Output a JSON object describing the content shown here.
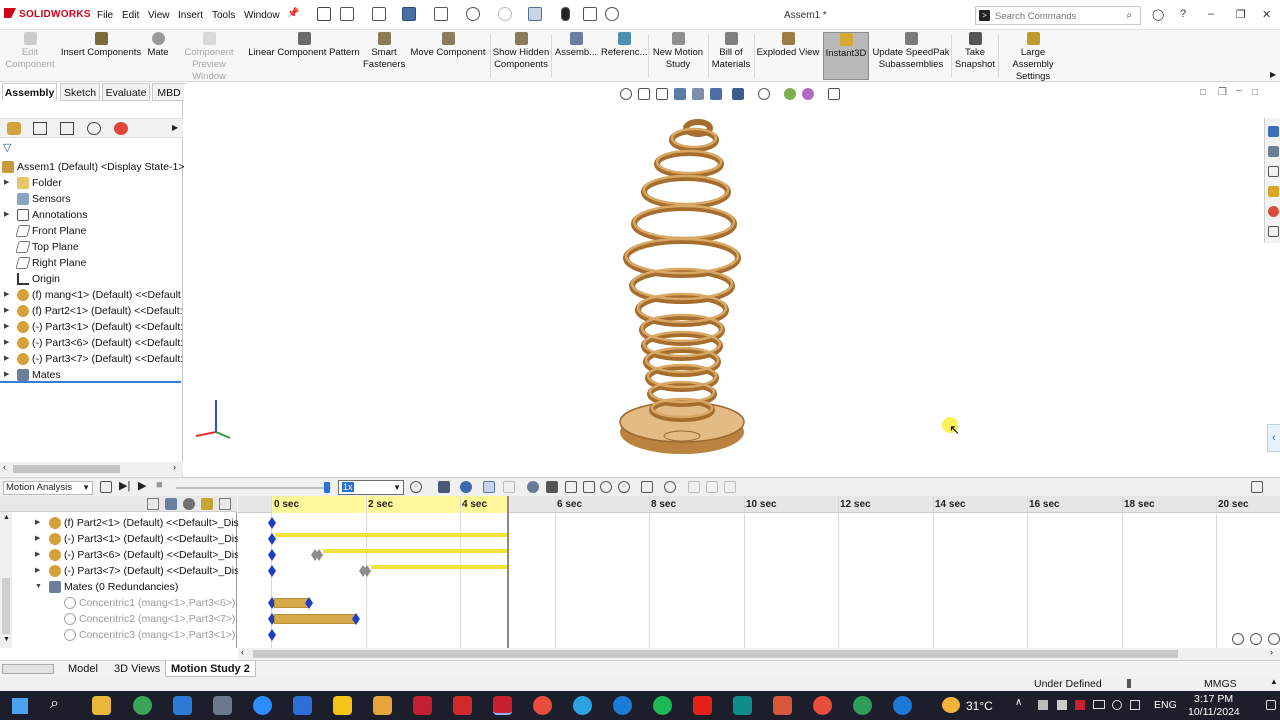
{
  "app": {
    "brand": "SOLIDWORKS",
    "document_title": "Assem1 *"
  },
  "menu": [
    "File",
    "Edit",
    "View",
    "Insert",
    "Tools",
    "Window"
  ],
  "search": {
    "placeholder": "Search Commands"
  },
  "commands": [
    {
      "label": "Edit\nComponent",
      "disabled": true,
      "icon": "edit-component-icon"
    },
    {
      "label": "Insert Components",
      "disabled": false,
      "icon": "insert-components-icon"
    },
    {
      "label": "Mate",
      "disabled": false,
      "icon": "mate-icon"
    },
    {
      "label": "Component\nPreview Window",
      "disabled": true,
      "icon": "preview-window-icon"
    },
    {
      "label": "Linear Component Pattern",
      "disabled": false,
      "icon": "linear-pattern-icon"
    },
    {
      "label": "Smart\nFasteners",
      "disabled": false,
      "icon": "smart-fasteners-icon"
    },
    {
      "label": "Move Component",
      "disabled": false,
      "icon": "move-component-icon"
    },
    {
      "label": "Show Hidden\nComponents",
      "disabled": false,
      "icon": "show-hidden-icon"
    },
    {
      "label": "Assemb...",
      "disabled": false,
      "icon": "assembly-features-icon"
    },
    {
      "label": "Referenc...",
      "disabled": false,
      "icon": "reference-geometry-icon"
    },
    {
      "label": "New Motion\nStudy",
      "disabled": false,
      "icon": "motion-study-icon"
    },
    {
      "label": "Bill of\nMaterials",
      "disabled": false,
      "icon": "bom-icon"
    },
    {
      "label": "Exploded View",
      "disabled": false,
      "icon": "exploded-view-icon"
    },
    {
      "label": "Instant3D",
      "disabled": false,
      "active": true,
      "icon": "instant3d-icon"
    },
    {
      "label": "Update SpeedPak\nSubassemblies",
      "disabled": false,
      "icon": "speedpak-icon"
    },
    {
      "label": "Take\nSnapshot",
      "disabled": false,
      "icon": "snapshot-icon"
    },
    {
      "label": "Large Assembly\nSettings",
      "disabled": false,
      "icon": "large-assembly-icon"
    }
  ],
  "cm_tabs": [
    "Assembly",
    "Sketch",
    "Evaluate",
    "MBD"
  ],
  "feature_tree": {
    "root": "Assem1 (Default) <Display State-1>",
    "items": [
      {
        "label": "Folder",
        "icon": "folder-icon"
      },
      {
        "label": "Sensors",
        "icon": "sensor-icon"
      },
      {
        "label": "Annotations",
        "icon": "annotations-icon"
      },
      {
        "label": "Front Plane",
        "icon": "plane-icon"
      },
      {
        "label": "Top Plane",
        "icon": "plane-icon"
      },
      {
        "label": "Right Plane",
        "icon": "plane-icon"
      },
      {
        "label": "Origin",
        "icon": "origin-icon"
      },
      {
        "label": "(f) mang<1> (Default) <<Default",
        "icon": "part-icon"
      },
      {
        "label": "(f) Part2<1> (Default) <<Default:",
        "icon": "part-icon"
      },
      {
        "label": "(-) Part3<1> (Default) <<Default:",
        "icon": "part-icon"
      },
      {
        "label": "(-) Part3<6> (Default) <<Default:",
        "icon": "part-icon"
      },
      {
        "label": "(-) Part3<7> (Default) <<Default:",
        "icon": "part-icon"
      },
      {
        "label": "Mates",
        "icon": "mates-icon"
      }
    ]
  },
  "motion": {
    "study_type": "Motion Analysis",
    "speed_value": "1x",
    "ticks": [
      "0 sec",
      "2 sec",
      "4 sec",
      "6 sec",
      "8 sec",
      "10 sec",
      "12 sec",
      "14 sec",
      "16 sec",
      "18 sec",
      "20 sec"
    ],
    "tree": [
      {
        "label": "(f) Part2<1> (Default) <<Default>_Dis",
        "dim": false
      },
      {
        "label": "(-) Part3<1> (Default) <<Default>_Dis",
        "dim": false
      },
      {
        "label": "(-) Part3<6> (Default) <<Default>_Dis",
        "dim": false
      },
      {
        "label": "(-) Part3<7> (Default) <<Default>_Dis",
        "dim": false
      },
      {
        "label": "Mates (0 Redundancies)",
        "dim": false
      },
      {
        "label": "Concentric1 (mang<1>,Part3<6>)",
        "dim": true
      },
      {
        "label": "Concentric2 (mang<1>,Part3<7>)",
        "dim": true
      },
      {
        "label": "Concentric3 (mang<1>,Part3<1>)",
        "dim": true
      }
    ]
  },
  "bottom_tabs": [
    "Model",
    "3D Views",
    "Motion Study 2"
  ],
  "status": {
    "state": "Under Defined",
    "units": "MMGS"
  },
  "taskbar": {
    "temperature": "31°C",
    "language": "ENG",
    "time": "3:17 PM",
    "date": "10/11/2024"
  },
  "colors": {
    "spring": "#c8914f",
    "keyframe": "#1e3ec9",
    "timebar": "#f1e23a",
    "active_tool": "#b9b9b9"
  }
}
